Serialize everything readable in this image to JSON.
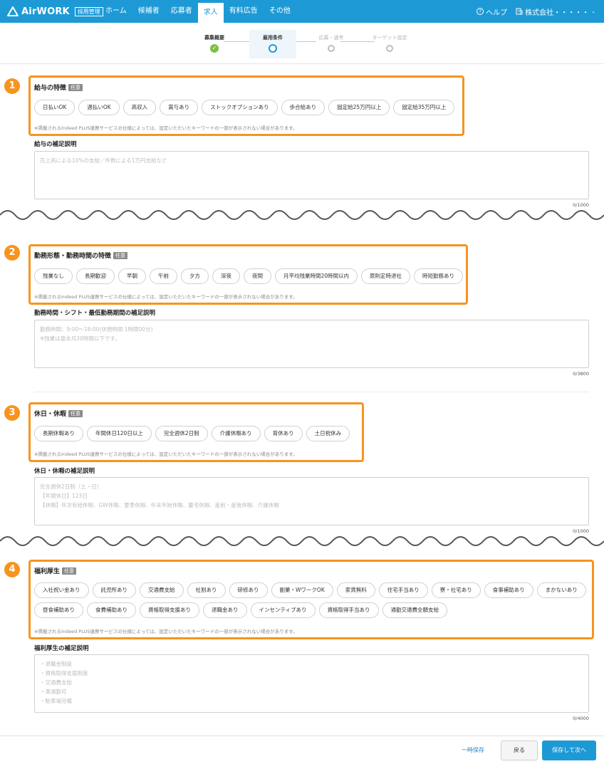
{
  "header": {
    "logo_text": "AirWORK",
    "logo_badge": "採用管理",
    "nav": [
      "ホーム",
      "候補者",
      "応募者",
      "求人",
      "有料広告",
      "その他"
    ],
    "active_nav": "求人",
    "help": "ヘルプ",
    "company": "株式会社・・・・・"
  },
  "stepper": {
    "steps": [
      {
        "label": "募集概要",
        "state": "done"
      },
      {
        "label": "雇用条件",
        "state": "current"
      },
      {
        "label": "応募・選考",
        "state": "future"
      },
      {
        "label": "ターゲット設定",
        "state": "future"
      }
    ]
  },
  "optional_badge": "任意",
  "note_text": "※掲載されるIndeed PLUS連携サービスの仕様によっては、設定いただいたキーワードの一部が表示されない場合があります。",
  "sections": [
    {
      "number": "1",
      "title": "給与の特徴",
      "chips": [
        "日払いOK",
        "週払いOK",
        "高収入",
        "賞与あり",
        "ストックオプションあり",
        "歩合給あり",
        "固定給25万円以上",
        "固定給35万円以上"
      ],
      "supplement_label": "給与の補足説明",
      "placeholder": "売上高による10%の支給／件数による1万円支給など",
      "counter": "0/1000"
    },
    {
      "number": "2",
      "title": "勤務形態・勤務時間の特徴",
      "chips": [
        "残業なし",
        "長期歓迎",
        "早朝",
        "午前",
        "夕方",
        "深夜",
        "夜間",
        "月平均残業時間20時間以内",
        "原則定時退社",
        "時短勤務あり"
      ],
      "supplement_label": "勤務時間・シフト・最低勤務期間の補足説明",
      "placeholder": "勤務時間：9:00〜18:00(休憩時間 1時間00分)\n※残業は基本月20時間以下です。",
      "counter": "0/3800"
    },
    {
      "number": "3",
      "title": "休日・休暇",
      "chips": [
        "長期休暇あり",
        "年間休日120日以上",
        "完全週休2日制",
        "介護休暇あり",
        "育休あり",
        "土日祝休み"
      ],
      "supplement_label": "休日・休暇の補足説明",
      "placeholder": "完全週休2日制（土・日）\n【年間休日】123日\n【休暇】年次有給休暇、GW休暇、夏季休暇、年末年始休暇、慶弔休暇、産前・産後休暇、介護休暇",
      "counter": "0/1000"
    },
    {
      "number": "4",
      "title": "福利厚生",
      "chips": [
        "入社祝い金あり",
        "託児所あり",
        "交通費支給",
        "社割あり",
        "研修あり",
        "副業・WワークOK",
        "家賃無料",
        "住宅手当あり",
        "寮・社宅あり",
        "食事補助あり",
        "まかないあり",
        "昼食補助あり",
        "食費補助あり",
        "資格取得支援あり",
        "退職金あり",
        "インセンティブあり",
        "資格取得手当あり",
        "通勤交通費全額支給"
      ],
      "supplement_label": "福利厚生の補足説明",
      "placeholder": "・退職金制度\n・資格取得支援制度\n・交通費支給\n・車通勤可\n・駐車場完備",
      "counter": "0/4000"
    }
  ],
  "footer": {
    "temp_save": "一時保存",
    "back": "戻る",
    "next": "保存して次へ"
  },
  "colors": {
    "brand": "#1d9ad6",
    "highlight": "#f7941d",
    "done": "#7ac143"
  }
}
